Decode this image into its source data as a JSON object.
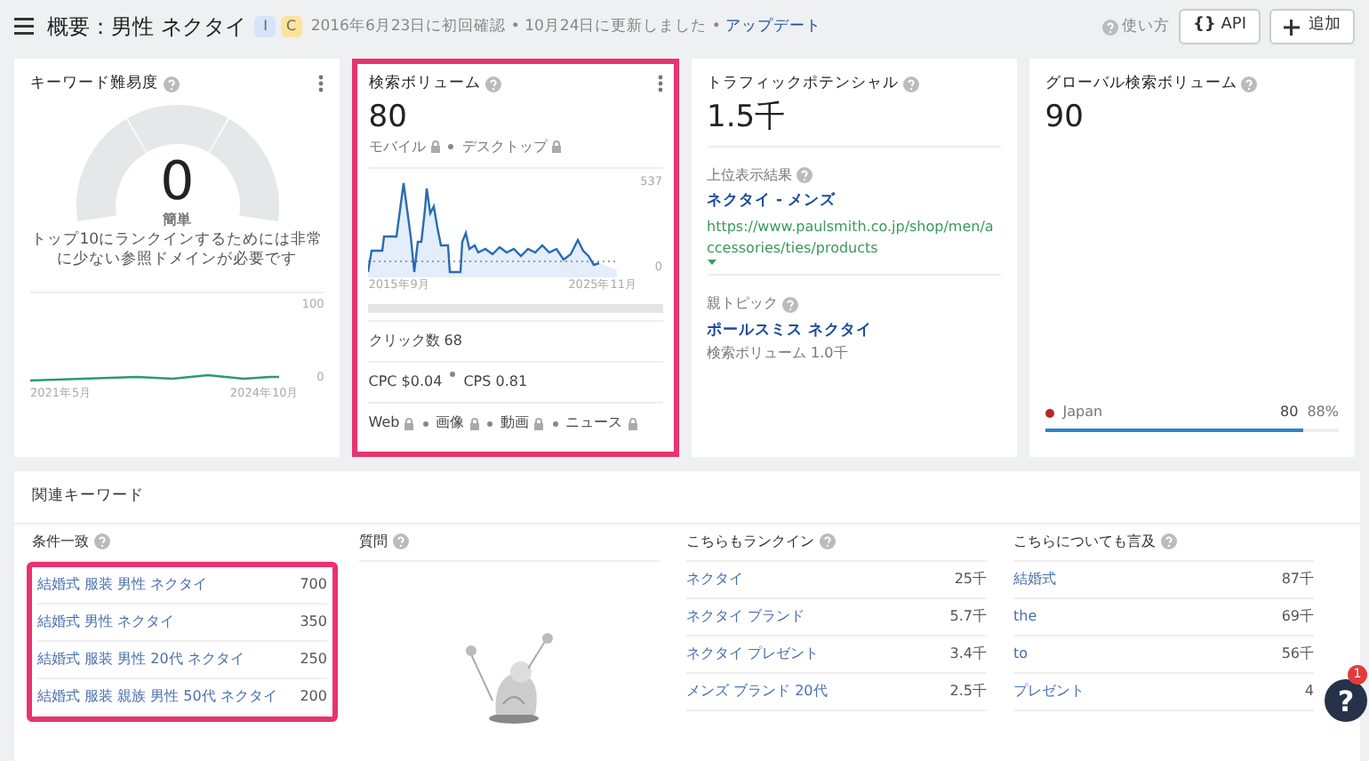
{
  "header": {
    "title": "概要：男性 ネクタイ",
    "badges": [
      {
        "label": "I",
        "color": "#d6e4fa"
      },
      {
        "label": "C",
        "color": "#fbe39a"
      }
    ],
    "info": "2016年6月23日に初回確認 • 10月24日に更新しました •",
    "update_link": "アップデート",
    "help": "使い方",
    "api_icon": "{}",
    "api": "API",
    "add": "追加"
  },
  "cards": [
    {
      "kind": "difficulty",
      "title": "キーワード難易度",
      "highlighted": false,
      "score": "0",
      "rating": "簡単",
      "description": "トップ10にランクインするためには非常に少ない参照ドメインが必要です",
      "y_max": "100",
      "y_min": "0",
      "x_start": "2021年5月",
      "x_end": "2024年10月"
    },
    {
      "kind": "volume",
      "title": "検索ボリューム",
      "highlighted": true,
      "value": "80",
      "devices": [
        {
          "label": "モバイル",
          "locked": true
        },
        {
          "label": "デスクトップ",
          "locked": true
        }
      ],
      "y_max": "537",
      "y_min": "0",
      "x_start": "2015年9月",
      "x_end": "2025年11月",
      "clicks": "クリック数 68",
      "costs": [
        "CPC $0.04",
        "CPS 0.81"
      ],
      "serp": [
        {
          "label": "Web",
          "locked": true
        },
        {
          "label": "画像",
          "locked": true
        },
        {
          "label": "動画",
          "locked": true
        },
        {
          "label": "ニュース",
          "locked": true
        }
      ]
    },
    {
      "kind": "traffic",
      "title": "トラフィックポテンシャル",
      "highlighted": false,
      "value": "1.5千",
      "top_label": "上位表示結果",
      "top_title": "ネクタイ - メンズ",
      "top_url": "https://www.paulsmith.co.jp/shop/men/accessories/ties/products",
      "parent_label": "親トピック",
      "parent": "ポールスミス ネクタイ",
      "parent_volume": "検索ボリューム 1.0千"
    },
    {
      "kind": "global",
      "title": "グローバル検索ボリューム",
      "highlighted": false,
      "value": "90",
      "countries": [
        {
          "name": "Japan",
          "volume": "80",
          "share": "88%",
          "level": 0.88,
          "color": "#b3262f"
        }
      ]
    }
  ],
  "related": {
    "title": "関連キーワード",
    "columns": [
      {
        "kind": "list",
        "title": "条件一致",
        "highlighted": true,
        "rows": [
          {
            "keyword": "結婚式 服装 男性 ネクタイ",
            "volume": "700"
          },
          {
            "keyword": "結婚式 男性 ネクタイ",
            "volume": "350"
          },
          {
            "keyword": "結婚式 服装 男性 20代 ネクタイ",
            "volume": "250"
          },
          {
            "keyword": "結婚式 服装 親族 男性 50代 ネクタイ",
            "volume": "200"
          }
        ]
      },
      {
        "kind": "empty",
        "title": "質問"
      },
      {
        "kind": "list",
        "title": "こちらもランクイン",
        "rows": [
          {
            "keyword": "ネクタイ",
            "volume": "25千"
          },
          {
            "keyword": "ネクタイ ブランド",
            "volume": "5.7千"
          },
          {
            "keyword": "ネクタイ プレゼント",
            "volume": "3.4千"
          },
          {
            "keyword": "メンズ ブランド 20代",
            "volume": "2.5千"
          }
        ]
      },
      {
        "kind": "list",
        "title": "こちらについても言及",
        "rows": [
          {
            "keyword": "結婚式",
            "volume": "87千"
          },
          {
            "keyword": "the",
            "volume": "69千"
          },
          {
            "keyword": "to",
            "volume": "56千"
          },
          {
            "keyword": "プレゼント",
            "volume": "4"
          }
        ]
      }
    ]
  },
  "help_button": {
    "label": "?",
    "badge": "1"
  }
}
